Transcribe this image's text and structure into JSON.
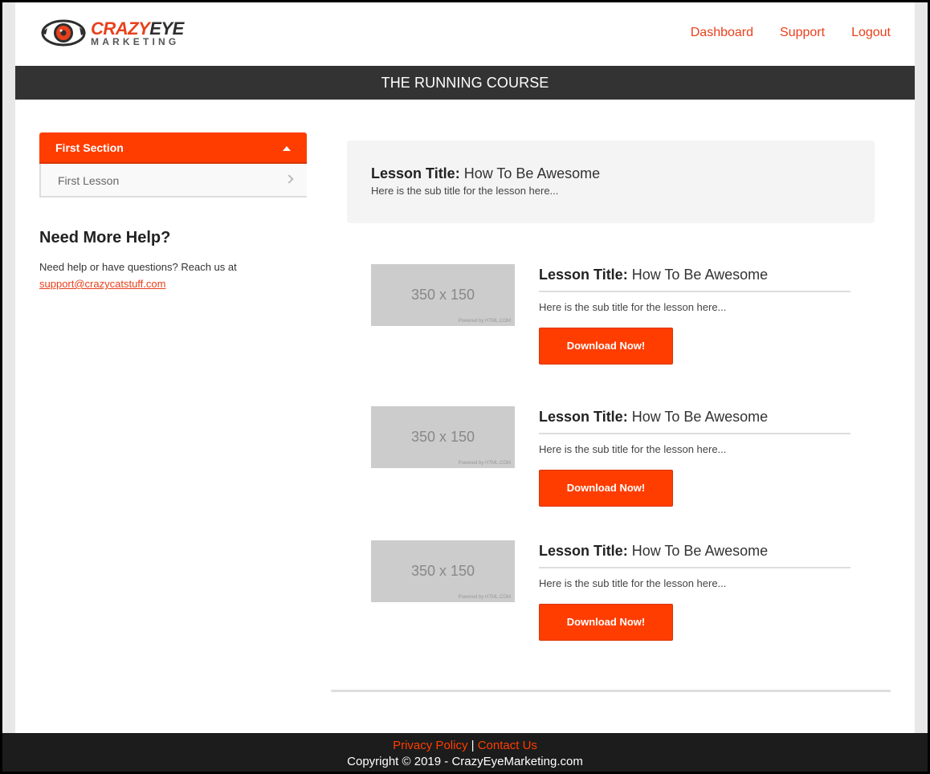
{
  "brand": {
    "word1": "CRAZY",
    "word2": "EYE",
    "tagline": "MARKETING",
    "accent_color": "#ff3d00"
  },
  "nav": {
    "items": [
      {
        "label": "Dashboard"
      },
      {
        "label": "Support"
      },
      {
        "label": "Logout"
      }
    ]
  },
  "course": {
    "title": "THE RUNNING COURSE"
  },
  "sidebar": {
    "section": {
      "label": "First Section",
      "icon": "caret-up-icon",
      "lessons": [
        {
          "label": "First Lesson",
          "icon": "chevron-right-icon"
        }
      ]
    },
    "help": {
      "title": "Need More Help?",
      "text": "Need help or have questions? Reach us at",
      "email": "support@crazycatstuff.com"
    }
  },
  "main": {
    "hero": {
      "title_label": "Lesson Title:",
      "title_value": "How To Be Awesome",
      "subtitle": "Here is the sub title for the lesson here..."
    },
    "lessons": [
      {
        "thumb_text": "350 x 150",
        "thumb_credit": "Powered by HTML.COM",
        "title_label": "Lesson Title:",
        "title_value": "How To Be Awesome",
        "subtitle": "Here is the sub title for the lesson here...",
        "button": "Download Now!"
      },
      {
        "thumb_text": "350 x 150",
        "thumb_credit": "Powered by HTML.COM",
        "title_label": "Lesson Title:",
        "title_value": "How To Be Awesome",
        "subtitle": "Here is the sub title for the lesson here...",
        "button": "Download Now!"
      },
      {
        "thumb_text": "350 x 150",
        "thumb_credit": "Powered by HTML.COM",
        "title_label": "Lesson Title:",
        "title_value": "How To Be Awesome",
        "subtitle": "Here is the sub title for the lesson here...",
        "button": "Download Now!"
      }
    ]
  },
  "footer": {
    "privacy": "Privacy Policy",
    "separator": "|",
    "contact": "Contact Us",
    "copyright": "Copyright © 2019 - CrazyEyeMarketing.com"
  }
}
